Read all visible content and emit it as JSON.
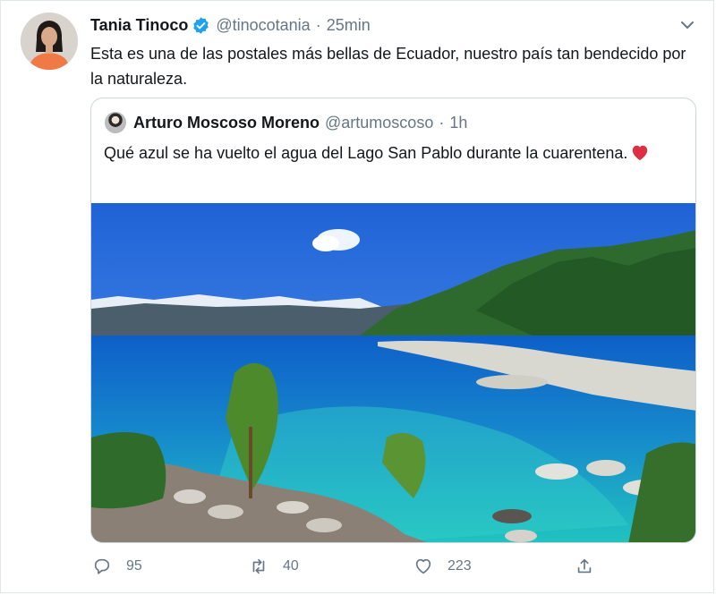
{
  "tweet": {
    "author_name": "Tania Tinoco",
    "handle": "@tinocotania",
    "separator": "·",
    "time": "25min",
    "text": "Esta es una de las postales más bellas de Ecuador, nuestro país tan bendecido por la naturaleza."
  },
  "quote": {
    "author_name": "Arturo Moscoso Moreno",
    "handle": "@artumoscoso",
    "separator": "·",
    "time": "1h",
    "text": "Qué azul se ha vuelto el agua del Lago San Pablo durante la cuarentena."
  },
  "actions": {
    "replies": "95",
    "retweets": "40",
    "likes": "223"
  },
  "icons": [
    "verified-icon",
    "chevron-down-icon",
    "heart-emoji",
    "reply-icon",
    "retweet-icon",
    "like-icon",
    "share-icon"
  ],
  "colors": {
    "link_blue": "#1da1f2",
    "muted_text": "#657786",
    "heart_red": "#e0245e",
    "border": "#ccd6dd"
  }
}
